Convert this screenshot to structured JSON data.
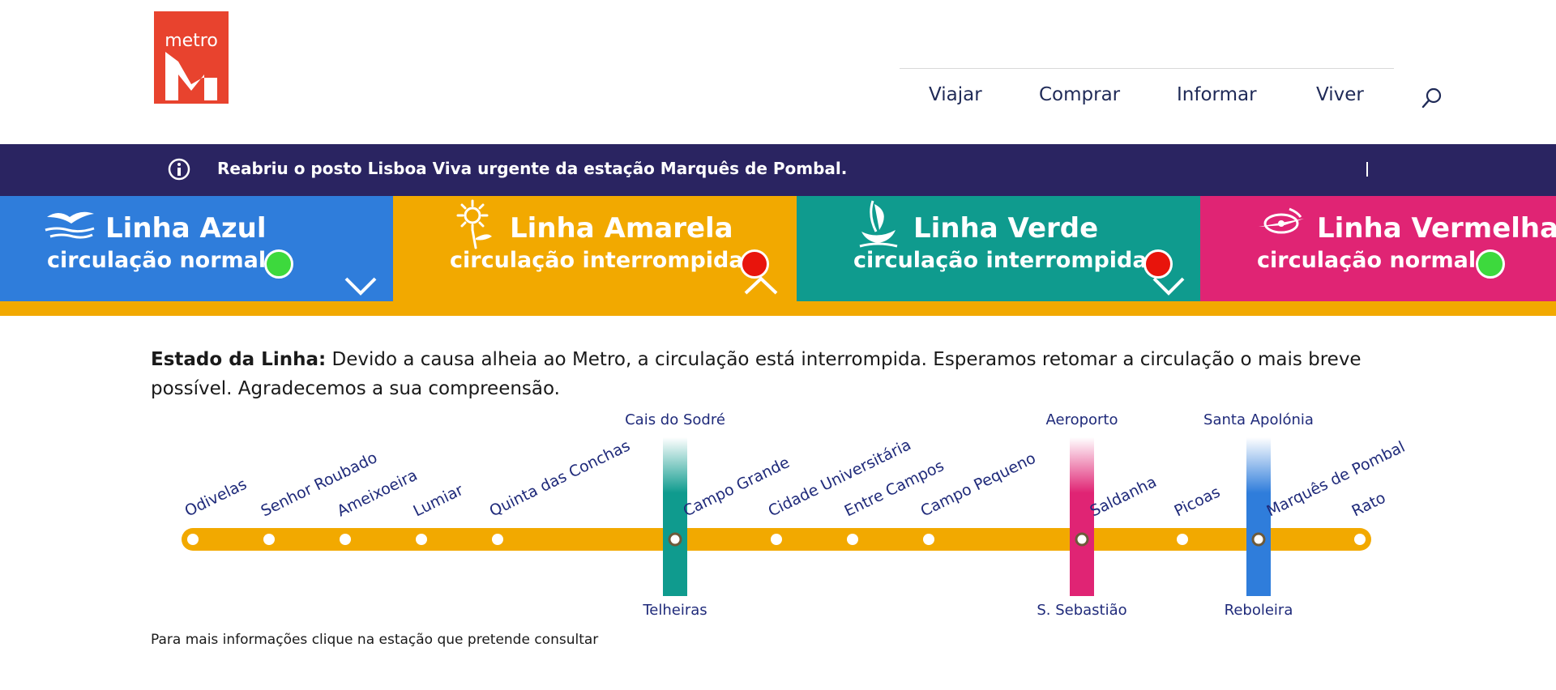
{
  "header": {
    "logo_text": "metro",
    "nav": [
      "Viajar",
      "Comprar",
      "Informar",
      "Viver"
    ]
  },
  "alert": {
    "text": "Reabriu o posto Lisboa Viva urgente da estação Marquês de Pombal."
  },
  "lines": [
    {
      "name": "Linha Azul",
      "status": "circulação normal",
      "color": "#2f7ddb",
      "status_color": "#3dd93d",
      "icon": "seagull-icon"
    },
    {
      "name": "Linha Amarela",
      "status": "circulação interrompida",
      "color": "#f2a900",
      "status_color": "#e8140c",
      "icon": "sunflower-icon"
    },
    {
      "name": "Linha Verde",
      "status": "circulação interrompida",
      "color": "#0f9b8e",
      "status_color": "#e8140c",
      "icon": "caravel-icon"
    },
    {
      "name": "Linha Vermelha",
      "status": "circulação normal",
      "color": "#e02474",
      "status_color": "#3dd93d",
      "icon": "compass-rose-icon"
    }
  ],
  "selected_line_bar_color": "#f2a900",
  "description": {
    "label": "Estado da Linha:",
    "text": " Devido a causa alheia ao Metro, a circulação está interrompida. Esperamos retomar a circulação o mais breve possível. Agradecemos a sua compreensão."
  },
  "stations": [
    "Odivelas",
    "Senhor Roubado",
    "Ameixoeira",
    "Lumiar",
    "Quinta das Conchas",
    "Campo Grande",
    "Cidade Universitária",
    "Entre Campos",
    "Campo Pequeno",
    "Saldanha",
    "Picoas",
    "Marquês de Pombal",
    "Rato"
  ],
  "connections": [
    {
      "top": "Cais do Sodré",
      "bottom": "Telheiras",
      "color": "#0f9b8e"
    },
    {
      "top": "Aeroporto",
      "bottom": "S. Sebastião",
      "color": "#e02474"
    },
    {
      "top": "Santa Apolónia",
      "bottom": "Reboleira",
      "color": "#2f7ddb"
    }
  ],
  "footer_note": "Para mais informações clique na estação que pretende consultar"
}
